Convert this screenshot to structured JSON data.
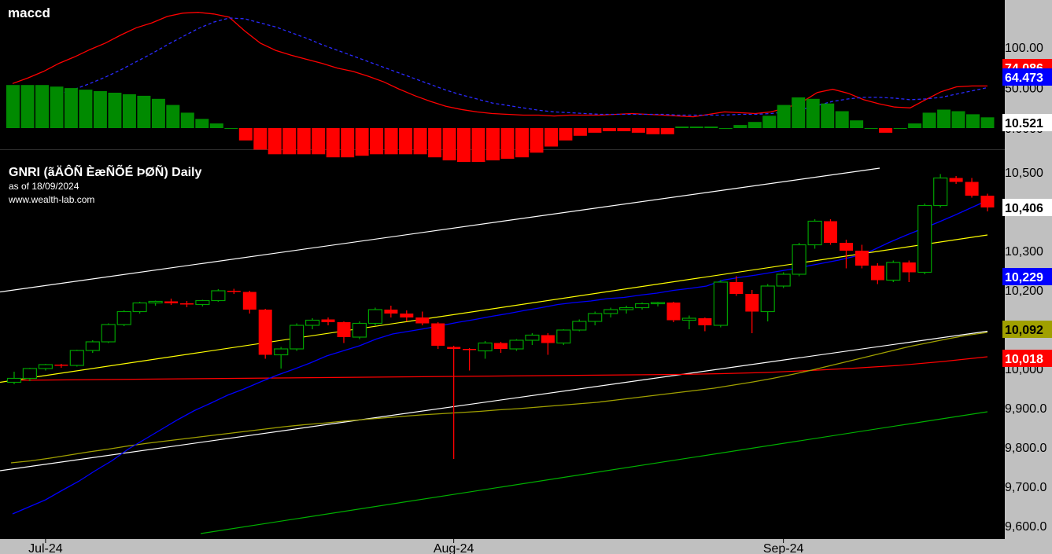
{
  "indicator_label": "maccd",
  "chart_title": "GNRI (ãÄÔÑ ÈæÑÕÉ ÞØÑ) Daily",
  "as_of": "as of 18/09/2024",
  "watermark": "www.wealth-lab.com",
  "colors": {
    "background": "#000000",
    "axis_bg": "#c0c0c0",
    "bull": "#00a000",
    "bear": "#ff0000",
    "macd": "#ff0000",
    "signal": "#2a2aff",
    "hist_pos": "#008a00",
    "hist_neg": "#ff0000",
    "upper_band": "#ffffff",
    "mid_band": "#ffff00",
    "lower_band": "#00b000",
    "ma_short": "#0000ff",
    "ma_long": "#ff0000",
    "ma_slow": "#a0a000",
    "ma_white": "#ffffff"
  },
  "chart_data": [
    {
      "type": "bar",
      "name": "macd-histogram-panel",
      "y_ticks": [
        "100.00",
        "50.000",
        "0.0000"
      ],
      "tags": [
        {
          "label": "74.086",
          "value": 74.086,
          "color": "#ff0000",
          "text_color": "#ffffff"
        },
        {
          "label": "64.473",
          "value": 64.473,
          "color": "#0000ff",
          "text_color": "#ffffff"
        },
        {
          "label": "10.521",
          "value": 10.521,
          "color": "#ffffff",
          "text_color": "#000000"
        }
      ],
      "histogram": [
        28,
        28,
        28,
        27,
        26,
        25,
        24,
        23,
        22,
        21,
        19,
        15,
        10,
        6,
        3,
        0,
        -8,
        -14,
        -17,
        -17,
        -17,
        -17,
        -19,
        -19,
        -18,
        -17,
        -17,
        -17,
        -17,
        -19,
        -21,
        -22,
        -22,
        -21,
        -20,
        -19,
        -16,
        -12,
        -8,
        -5,
        -3,
        -2,
        -2,
        -3,
        -4,
        -4,
        1,
        1,
        1,
        0,
        2,
        4,
        8,
        15,
        20,
        19,
        16,
        11,
        5,
        0,
        -3,
        0,
        3,
        10,
        12,
        11,
        9,
        7
      ],
      "macd": [
        55,
        62,
        70,
        80,
        88,
        97,
        105,
        115,
        124,
        130,
        138,
        142,
        143,
        141,
        137,
        120,
        105,
        96,
        90,
        85,
        80,
        74,
        70,
        64,
        57,
        48,
        40,
        33,
        27,
        23,
        20,
        18,
        17,
        16,
        16,
        15,
        16,
        16,
        16,
        17,
        18,
        17,
        16,
        15,
        14,
        17,
        20,
        19,
        18,
        20,
        25,
        32,
        44,
        48,
        43,
        35,
        30,
        26,
        25,
        35,
        45,
        51,
        52,
        52
      ],
      "signal": [
        null,
        null,
        null,
        42,
        48,
        55,
        63,
        72,
        82,
        92,
        103,
        113,
        123,
        131,
        136,
        135,
        130,
        125,
        118,
        111,
        103,
        96,
        89,
        82,
        75,
        68,
        61,
        54,
        47,
        41,
        36,
        31,
        28,
        25,
        22,
        20,
        19,
        18,
        17,
        17,
        17,
        17,
        17,
        16,
        16,
        16,
        16,
        17,
        17,
        18,
        20,
        23,
        28,
        33,
        36,
        38,
        38,
        37,
        35,
        36,
        38,
        42,
        46,
        50
      ]
    },
    {
      "type": "candlestick",
      "name": "price-panel",
      "x_ticks": [
        "Jul-24",
        "Aug-24",
        "Sep-24"
      ],
      "y_ticks": [
        "10,500",
        "10,300",
        "10,200",
        "10,000",
        "9,900.0",
        "9,800.0",
        "9,700.0",
        "9,600.0"
      ],
      "tags": [
        {
          "label": "10,406",
          "value": 10406,
          "color": "#ffffff",
          "text_color": "#000000"
        },
        {
          "label": "10,229",
          "value": 10229,
          "color": "#0000ff",
          "text_color": "#ffffff"
        },
        {
          "label": "10,092",
          "value": 10092,
          "color": "#a0a000",
          "text_color": "#000000"
        },
        {
          "label": "10,018",
          "value": 10018,
          "color": "#ff0000",
          "text_color": "#ffffff"
        }
      ],
      "ohlc": [
        [
          9965,
          9992,
          9960,
          9975
        ],
        [
          9975,
          10002,
          9968,
          10000
        ],
        [
          10000,
          10012,
          9995,
          10010
        ],
        [
          10010,
          10012,
          10002,
          10007
        ],
        [
          10008,
          10048,
          10005,
          10046
        ],
        [
          10046,
          10072,
          10040,
          10068
        ],
        [
          10068,
          10115,
          10065,
          10112
        ],
        [
          10112,
          10148,
          10108,
          10145
        ],
        [
          10145,
          10170,
          10140,
          10167
        ],
        [
          10167,
          10173,
          10160,
          10171
        ],
        [
          10171,
          10178,
          10162,
          10166
        ],
        [
          10166,
          10172,
          10156,
          10163
        ],
        [
          10163,
          10175,
          10158,
          10173
        ],
        [
          10173,
          10202,
          10170,
          10198
        ],
        [
          10198,
          10203,
          10190,
          10195
        ],
        [
          10195,
          10198,
          10140,
          10150
        ],
        [
          10150,
          10152,
          10025,
          10035
        ],
        [
          10035,
          10055,
          10000,
          10050
        ],
        [
          10050,
          10115,
          10045,
          10110
        ],
        [
          10110,
          10128,
          10100,
          10123
        ],
        [
          10125,
          10130,
          10110,
          10118
        ],
        [
          10118,
          10120,
          10065,
          10080
        ],
        [
          10080,
          10120,
          10075,
          10115
        ],
        [
          10115,
          10155,
          10110,
          10150
        ],
        [
          10150,
          10160,
          10130,
          10140
        ],
        [
          10140,
          10148,
          10120,
          10130
        ],
        [
          10130,
          10145,
          10110,
          10115
        ],
        [
          10115,
          10118,
          10050,
          10058
        ],
        [
          10055,
          10058,
          9770,
          10050
        ],
        [
          10050,
          10052,
          9995,
          10047
        ],
        [
          10045,
          10070,
          10025,
          10065
        ],
        [
          10065,
          10068,
          10040,
          10050
        ],
        [
          10050,
          10075,
          10045,
          10072
        ],
        [
          10072,
          10090,
          10060,
          10085
        ],
        [
          10085,
          10090,
          10035,
          10065
        ],
        [
          10065,
          10100,
          10060,
          10098
        ],
        [
          10098,
          10125,
          10095,
          10120
        ],
        [
          10120,
          10145,
          10110,
          10140
        ],
        [
          10140,
          10155,
          10130,
          10150
        ],
        [
          10150,
          10160,
          10140,
          10155
        ],
        [
          10155,
          10168,
          10150,
          10165
        ],
        [
          10165,
          10170,
          10158,
          10168
        ],
        [
          10168,
          10170,
          10118,
          10123
        ],
        [
          10123,
          10135,
          10100,
          10128
        ],
        [
          10128,
          10130,
          10095,
          10110
        ],
        [
          10110,
          10225,
          10105,
          10220
        ],
        [
          10220,
          10235,
          10185,
          10190
        ],
        [
          10190,
          10200,
          10090,
          10145
        ],
        [
          10145,
          10215,
          10120,
          10210
        ],
        [
          10210,
          10245,
          10205,
          10240
        ],
        [
          10240,
          10320,
          10235,
          10315
        ],
        [
          10315,
          10380,
          10305,
          10375
        ],
        [
          10375,
          10380,
          10315,
          10320
        ],
        [
          10320,
          10328,
          10255,
          10300
        ],
        [
          10300,
          10315,
          10255,
          10262
        ],
        [
          10262,
          10268,
          10215,
          10225
        ],
        [
          10225,
          10275,
          10220,
          10270
        ],
        [
          10270,
          10275,
          10220,
          10245
        ],
        [
          10245,
          10420,
          10240,
          10415
        ],
        [
          10415,
          10495,
          10410,
          10485
        ],
        [
          10485,
          10490,
          10470,
          10475
        ],
        [
          10475,
          10485,
          10435,
          10440
        ],
        [
          10440,
          10445,
          10400,
          10410
        ]
      ],
      "upper_band": {
        "start": 10195,
        "end": 10510
      },
      "mid_band": {
        "start": 9965,
        "end": 10340
      },
      "lower_band": {
        "start": 9580,
        "end": 9890
      },
      "ma_white": {
        "start": 9740,
        "end": 10095
      },
      "ma_short": [
        9630,
        9648,
        9666,
        9690,
        9713,
        9740,
        9765,
        9795,
        9820,
        9845,
        9870,
        9893,
        9912,
        9932,
        9948,
        9966,
        9983,
        9998,
        10014,
        10032,
        10045,
        10058,
        10075,
        10088,
        10095,
        10102,
        10110,
        10118,
        10125,
        10133,
        10140,
        10148,
        10155,
        10163,
        10168,
        10172,
        10178,
        10181,
        10187,
        10192,
        10199,
        10204,
        10210,
        10225,
        10232,
        10238,
        10245,
        10252,
        10260,
        10268,
        10276,
        10286,
        10300,
        10320,
        10338,
        10355,
        10372,
        10390,
        10409,
        10428,
        10445,
        10462,
        10478,
        10490,
        10500,
        10512,
        10520,
        10535,
        10545,
        10550,
        10560,
        10575,
        10590,
        10610,
        10630,
        10645,
        10660
      ],
      "ma_long_start": 9970,
      "ma_long_end": 10030,
      "ma_slow": [
        9760,
        9765,
        9772,
        9780,
        9788,
        9795,
        9803,
        9810,
        9816,
        9822,
        9828,
        9834,
        9840,
        9846,
        9852,
        9857,
        9861,
        9866,
        9870,
        9874,
        9878,
        9882,
        9885,
        9888,
        9891,
        9895,
        9898,
        9902,
        9906,
        9910,
        9914,
        9920,
        9926,
        9932,
        9938,
        9944,
        9950,
        9958,
        9966,
        9975,
        9985,
        9996,
        10008,
        10020,
        10032,
        10044,
        10056,
        10066,
        10076,
        10085,
        10092
      ]
    }
  ]
}
